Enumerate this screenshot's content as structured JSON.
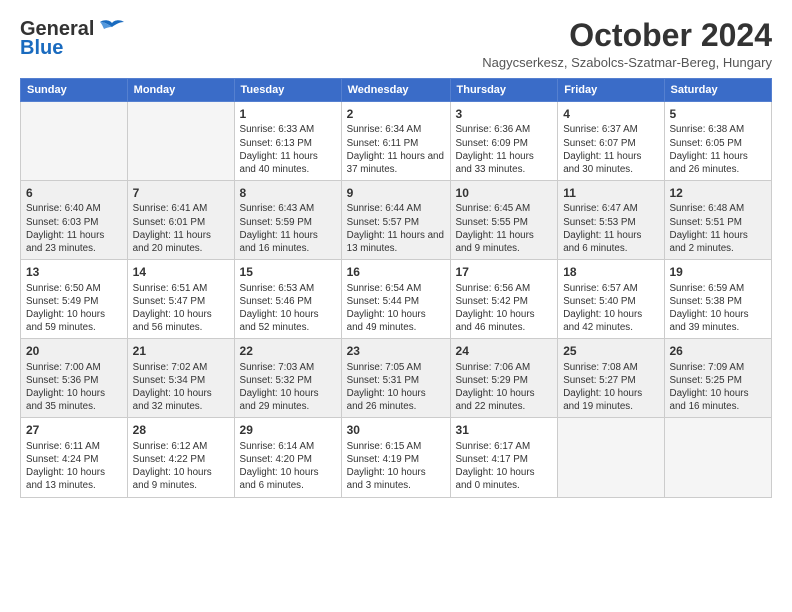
{
  "logo": {
    "line1": "General",
    "line2": "Blue"
  },
  "header": {
    "month": "October 2024",
    "location": "Nagycserkesz, Szabolcs-Szatmar-Bereg, Hungary"
  },
  "days_of_week": [
    "Sunday",
    "Monday",
    "Tuesday",
    "Wednesday",
    "Thursday",
    "Friday",
    "Saturday"
  ],
  "weeks": [
    [
      {
        "day": "",
        "info": ""
      },
      {
        "day": "",
        "info": ""
      },
      {
        "day": "1",
        "info": "Sunrise: 6:33 AM\nSunset: 6:13 PM\nDaylight: 11 hours and 40 minutes."
      },
      {
        "day": "2",
        "info": "Sunrise: 6:34 AM\nSunset: 6:11 PM\nDaylight: 11 hours and 37 minutes."
      },
      {
        "day": "3",
        "info": "Sunrise: 6:36 AM\nSunset: 6:09 PM\nDaylight: 11 hours and 33 minutes."
      },
      {
        "day": "4",
        "info": "Sunrise: 6:37 AM\nSunset: 6:07 PM\nDaylight: 11 hours and 30 minutes."
      },
      {
        "day": "5",
        "info": "Sunrise: 6:38 AM\nSunset: 6:05 PM\nDaylight: 11 hours and 26 minutes."
      }
    ],
    [
      {
        "day": "6",
        "info": "Sunrise: 6:40 AM\nSunset: 6:03 PM\nDaylight: 11 hours and 23 minutes."
      },
      {
        "day": "7",
        "info": "Sunrise: 6:41 AM\nSunset: 6:01 PM\nDaylight: 11 hours and 20 minutes."
      },
      {
        "day": "8",
        "info": "Sunrise: 6:43 AM\nSunset: 5:59 PM\nDaylight: 11 hours and 16 minutes."
      },
      {
        "day": "9",
        "info": "Sunrise: 6:44 AM\nSunset: 5:57 PM\nDaylight: 11 hours and 13 minutes."
      },
      {
        "day": "10",
        "info": "Sunrise: 6:45 AM\nSunset: 5:55 PM\nDaylight: 11 hours and 9 minutes."
      },
      {
        "day": "11",
        "info": "Sunrise: 6:47 AM\nSunset: 5:53 PM\nDaylight: 11 hours and 6 minutes."
      },
      {
        "day": "12",
        "info": "Sunrise: 6:48 AM\nSunset: 5:51 PM\nDaylight: 11 hours and 2 minutes."
      }
    ],
    [
      {
        "day": "13",
        "info": "Sunrise: 6:50 AM\nSunset: 5:49 PM\nDaylight: 10 hours and 59 minutes."
      },
      {
        "day": "14",
        "info": "Sunrise: 6:51 AM\nSunset: 5:47 PM\nDaylight: 10 hours and 56 minutes."
      },
      {
        "day": "15",
        "info": "Sunrise: 6:53 AM\nSunset: 5:46 PM\nDaylight: 10 hours and 52 minutes."
      },
      {
        "day": "16",
        "info": "Sunrise: 6:54 AM\nSunset: 5:44 PM\nDaylight: 10 hours and 49 minutes."
      },
      {
        "day": "17",
        "info": "Sunrise: 6:56 AM\nSunset: 5:42 PM\nDaylight: 10 hours and 46 minutes."
      },
      {
        "day": "18",
        "info": "Sunrise: 6:57 AM\nSunset: 5:40 PM\nDaylight: 10 hours and 42 minutes."
      },
      {
        "day": "19",
        "info": "Sunrise: 6:59 AM\nSunset: 5:38 PM\nDaylight: 10 hours and 39 minutes."
      }
    ],
    [
      {
        "day": "20",
        "info": "Sunrise: 7:00 AM\nSunset: 5:36 PM\nDaylight: 10 hours and 35 minutes."
      },
      {
        "day": "21",
        "info": "Sunrise: 7:02 AM\nSunset: 5:34 PM\nDaylight: 10 hours and 32 minutes."
      },
      {
        "day": "22",
        "info": "Sunrise: 7:03 AM\nSunset: 5:32 PM\nDaylight: 10 hours and 29 minutes."
      },
      {
        "day": "23",
        "info": "Sunrise: 7:05 AM\nSunset: 5:31 PM\nDaylight: 10 hours and 26 minutes."
      },
      {
        "day": "24",
        "info": "Sunrise: 7:06 AM\nSunset: 5:29 PM\nDaylight: 10 hours and 22 minutes."
      },
      {
        "day": "25",
        "info": "Sunrise: 7:08 AM\nSunset: 5:27 PM\nDaylight: 10 hours and 19 minutes."
      },
      {
        "day": "26",
        "info": "Sunrise: 7:09 AM\nSunset: 5:25 PM\nDaylight: 10 hours and 16 minutes."
      }
    ],
    [
      {
        "day": "27",
        "info": "Sunrise: 6:11 AM\nSunset: 4:24 PM\nDaylight: 10 hours and 13 minutes."
      },
      {
        "day": "28",
        "info": "Sunrise: 6:12 AM\nSunset: 4:22 PM\nDaylight: 10 hours and 9 minutes."
      },
      {
        "day": "29",
        "info": "Sunrise: 6:14 AM\nSunset: 4:20 PM\nDaylight: 10 hours and 6 minutes."
      },
      {
        "day": "30",
        "info": "Sunrise: 6:15 AM\nSunset: 4:19 PM\nDaylight: 10 hours and 3 minutes."
      },
      {
        "day": "31",
        "info": "Sunrise: 6:17 AM\nSunset: 4:17 PM\nDaylight: 10 hours and 0 minutes."
      },
      {
        "day": "",
        "info": ""
      },
      {
        "day": "",
        "info": ""
      }
    ]
  ]
}
